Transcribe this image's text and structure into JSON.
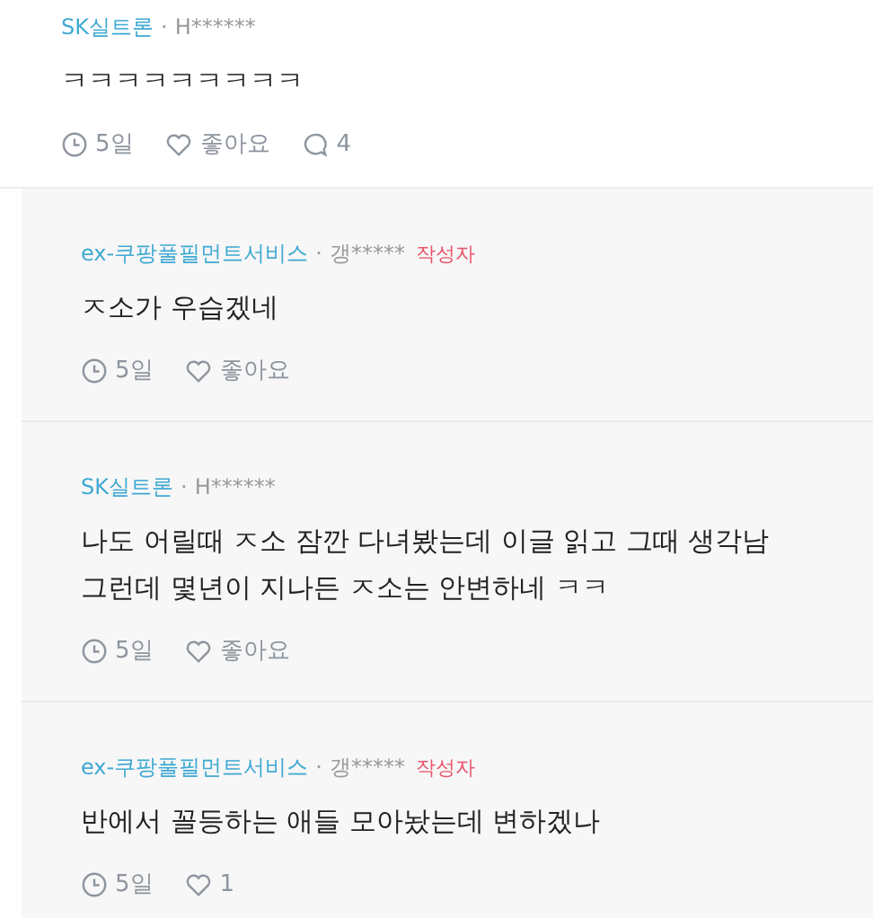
{
  "comment": {
    "company": "SK실트론",
    "separator": "·",
    "user": "H******",
    "body": "ㅋㅋㅋㅋㅋㅋㅋㅋㅋ",
    "time": "5일",
    "likes": "좋아요",
    "replies_count": "4"
  },
  "replies": [
    {
      "company": "ex-쿠팡풀필먼트서비스",
      "separator": "·",
      "user": "갱*****",
      "badge": "작성자",
      "body": "ㅈ소가 우습겠네",
      "time": "5일",
      "likes": "좋아요"
    },
    {
      "company": "SK실트론",
      "separator": "·",
      "user": "H******",
      "body": "나도 어릴때 ㅈ소 잠깐 다녀봤는데 이글 읽고 그때 생각남\n그런데 몇년이 지나든 ㅈ소는 안변하네 ㅋㅋ",
      "time": "5일",
      "likes": "좋아요"
    },
    {
      "company": "ex-쿠팡풀필먼트서비스",
      "separator": "·",
      "user": "갱*****",
      "badge": "작성자",
      "body": "반에서 꼴등하는 애들 모아놨는데 변하겠나",
      "time": "5일",
      "likes": "1"
    }
  ]
}
